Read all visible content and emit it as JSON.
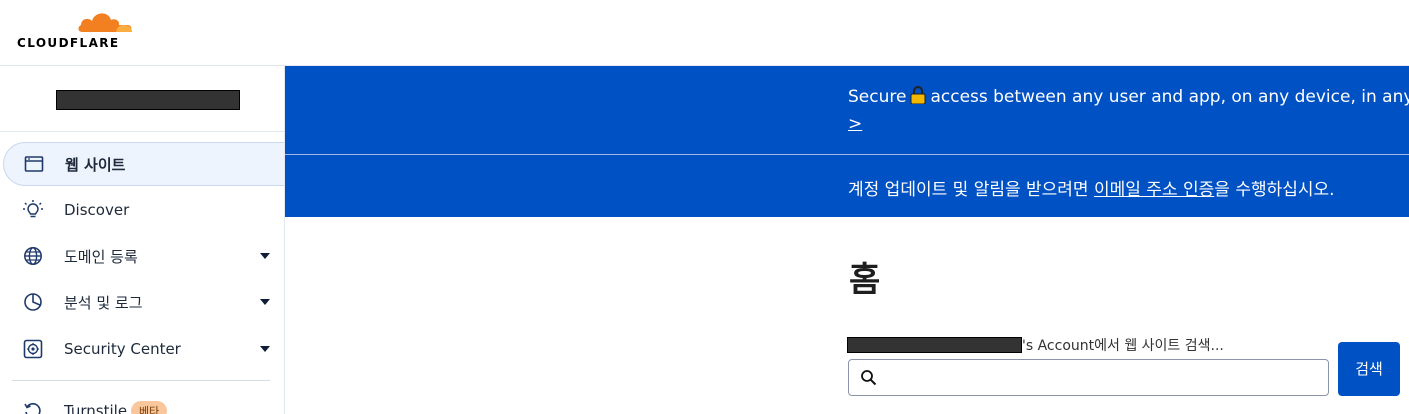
{
  "brand": {
    "logo_text": "CLOUDFLARE",
    "accent": "#f38020",
    "primary": "#0051c3"
  },
  "sidebar": {
    "items": [
      {
        "label": "웹 사이트",
        "icon": "browser-window-icon",
        "active": true
      },
      {
        "label": "Discover",
        "icon": "lightbulb-icon"
      },
      {
        "label": "도메인 등록",
        "icon": "globe-icon",
        "expandable": true
      },
      {
        "label": "분석 및 로그",
        "icon": "pie-chart-icon",
        "expandable": true
      },
      {
        "label": "Security Center",
        "icon": "security-center-icon",
        "expandable": true
      },
      {
        "label": "Turnstile",
        "icon": "turnstile-icon",
        "badge": "베타"
      }
    ]
  },
  "banners": {
    "zero_trust": {
      "text_before": "Secure",
      "text_after": "access between any user and app, on any device, in any lo",
      "link": ">"
    },
    "verify_email": {
      "text_before": "계정 업데이트 및 알림을 받으려면 ",
      "link": "이메일 주소 인증",
      "text_after": "을 수행하십시오."
    }
  },
  "main": {
    "title": "홈",
    "search_label_suffix": "'s Account에서 웹 사이트 검색...",
    "search_value": "",
    "search_button": "검색"
  }
}
